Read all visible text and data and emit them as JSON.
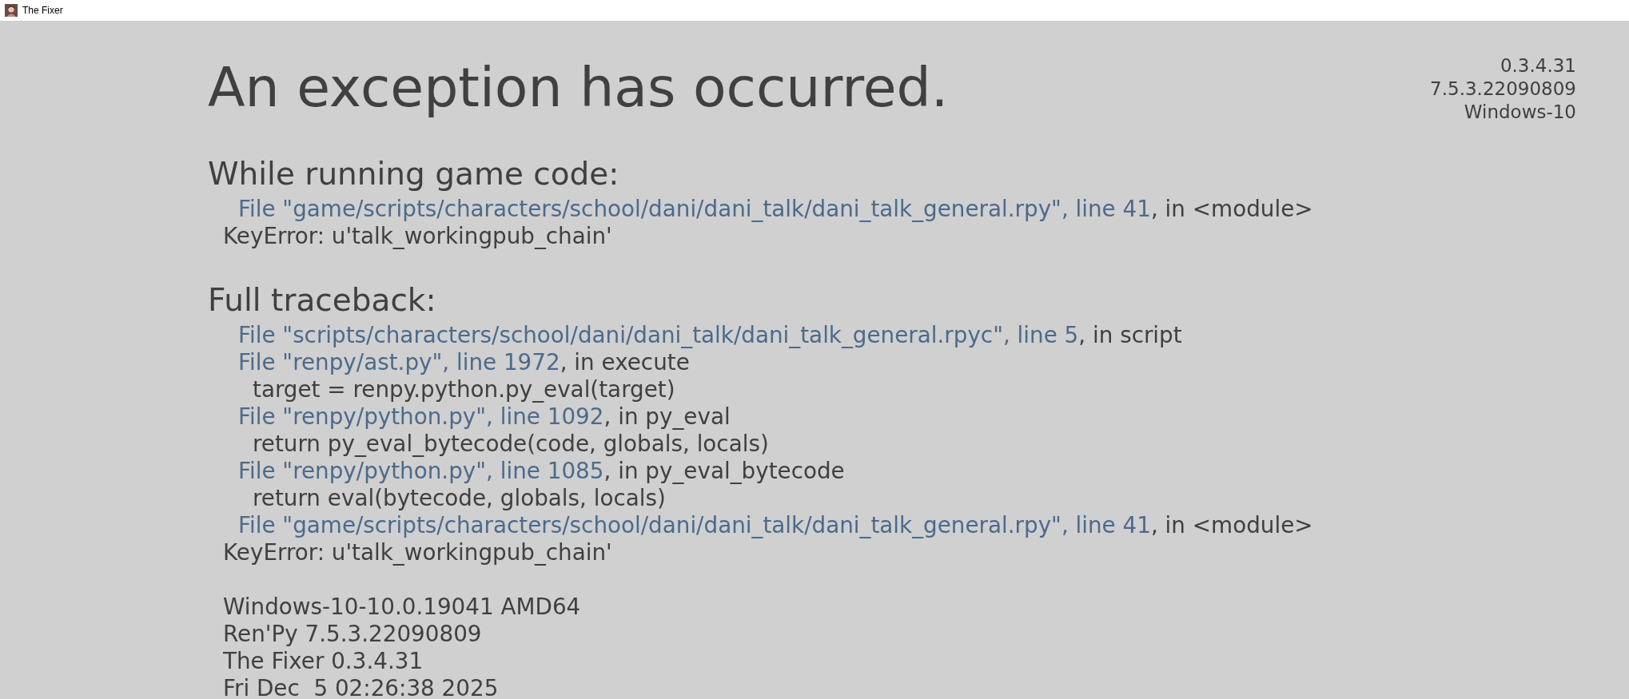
{
  "window": {
    "title": "The Fixer"
  },
  "heading": "An exception has occurred.",
  "version_info": [
    "0.3.4.31",
    "7.5.3.22090809",
    "Windows-10"
  ],
  "sections": [
    {
      "title": "While running game code:",
      "lines": [
        {
          "kind": "file",
          "link": "File \"game/scripts/characters/school/dani/dani_talk/dani_talk_general.rpy\", line 41",
          "rest": ", in <module>"
        },
        {
          "kind": "error",
          "text": "KeyError: u'talk_workingpub_chain'"
        }
      ]
    },
    {
      "title": "Full traceback:",
      "lines": [
        {
          "kind": "file",
          "link": "File \"scripts/characters/school/dani/dani_talk/dani_talk_general.rpyc\", line 5",
          "rest": ", in script"
        },
        {
          "kind": "file",
          "link": "File \"renpy/ast.py\", line 1972",
          "rest": ", in execute"
        },
        {
          "kind": "code",
          "text": "target = renpy.python.py_eval(target)"
        },
        {
          "kind": "file",
          "link": "File \"renpy/python.py\", line 1092",
          "rest": ", in py_eval"
        },
        {
          "kind": "code",
          "text": "return py_eval_bytecode(code, globals, locals)"
        },
        {
          "kind": "file",
          "link": "File \"renpy/python.py\", line 1085",
          "rest": ", in py_eval_bytecode"
        },
        {
          "kind": "code",
          "text": "return eval(bytecode, globals, locals)"
        },
        {
          "kind": "file",
          "link": "File \"game/scripts/characters/school/dani/dani_talk/dani_talk_general.rpy\", line 41",
          "rest": ", in <module>"
        },
        {
          "kind": "error",
          "text": "KeyError: u'talk_workingpub_chain'"
        }
      ]
    }
  ],
  "system_info": [
    "Windows-10-10.0.19041 AMD64",
    "Ren'Py 7.5.3.22090809",
    "The Fixer 0.3.4.31",
    "Fri Dec  5 02:26:38 2025"
  ]
}
